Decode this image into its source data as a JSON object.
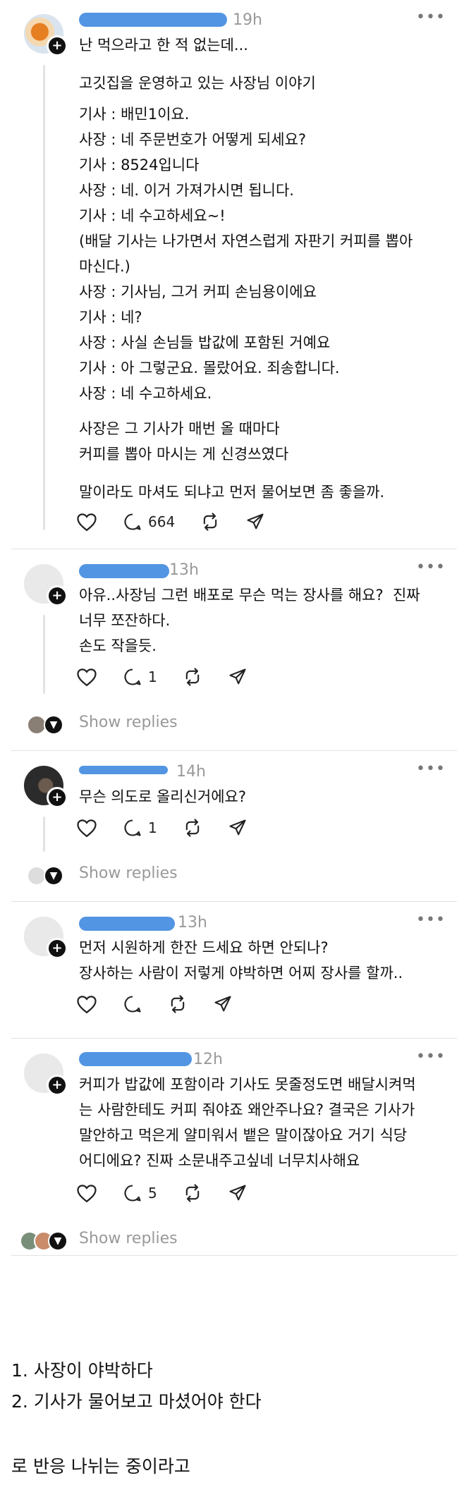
{
  "main_post": {
    "time": "19h",
    "title": "난 먹으라고 한 적 없는데...",
    "body": "고깃집을 운영하고 있는 사장님 이야기",
    "dialogue": [
      "기사 : 배민1이요.",
      "사장 : 네 주문번호가 어떻게 되세요?",
      "기사 : 8524입니다",
      "사장 : 네. 이거 가져가시면 됩니다.",
      "기사 : 네 수고하세요~!",
      "(배달 기사는 나가면서 자연스럽게 자판기 커피를 뽑아",
      "마신다.)",
      "사장 : 기사님, 그거 커피 손님용이에요",
      "기사 : 네?",
      "사장 : 사실 손님들 밥값에 포함된 거예요",
      "기사 : 아 그렇군요. 몰랐어요. 죄송합니다.",
      "사장 : 네 수고하세요."
    ],
    "para2": [
      "사장은 그 기사가 매번 올 때마다",
      "커피를 뽑아 마시는 게 신경쓰였다"
    ],
    "para3": "말이라도 마셔도 되냐고 먼저 물어보면 좀 좋을까.",
    "reply_count": "664"
  },
  "replies": [
    {
      "time": "13h",
      "lines": [
        "아유..사장님 그런 배포로 무슨 먹는 장사를 해요?  진짜",
        "너무 쪼잔하다.",
        "손도 작을듯."
      ],
      "reply_count": "1",
      "show_replies": "Show replies"
    },
    {
      "time": "14h",
      "lines": [
        "무슨 의도로 올리신거에요?"
      ],
      "reply_count": "1",
      "show_replies": "Show replies"
    },
    {
      "time": "13h",
      "lines": [
        "먼저 시원하게 한잔 드세요 하면 안되나?",
        "장사하는 사람이 저렇게 야박하면 어찌 장사를 할까.."
      ],
      "reply_count": "",
      "show_replies": ""
    },
    {
      "time": "12h",
      "lines": [
        "커피가 밥값에 포함이라 기사도 못줄정도면 배달시켜먹",
        "는 사람한테도 커피 줘야죠 왜안주나요? 결국은 기사가",
        "말안하고 먹은게 얄미워서 뱉은 말이잖아요 거기 식당",
        "어디에요? 진짜 소문내주고싶네 너무치사해요"
      ],
      "reply_count": "5",
      "show_replies": "Show replies"
    }
  ],
  "footer": {
    "line1": "1. 사장이 야박하다",
    "line2": "2. 기사가 물어보고 마셨어야 한다",
    "line3": "로 반응 나뉘는 중이라고"
  },
  "icons": [
    "heart-icon",
    "comment-icon",
    "repost-icon",
    "share-icon",
    "more-icon",
    "follow-plus-icon",
    "chevron-down-icon"
  ]
}
